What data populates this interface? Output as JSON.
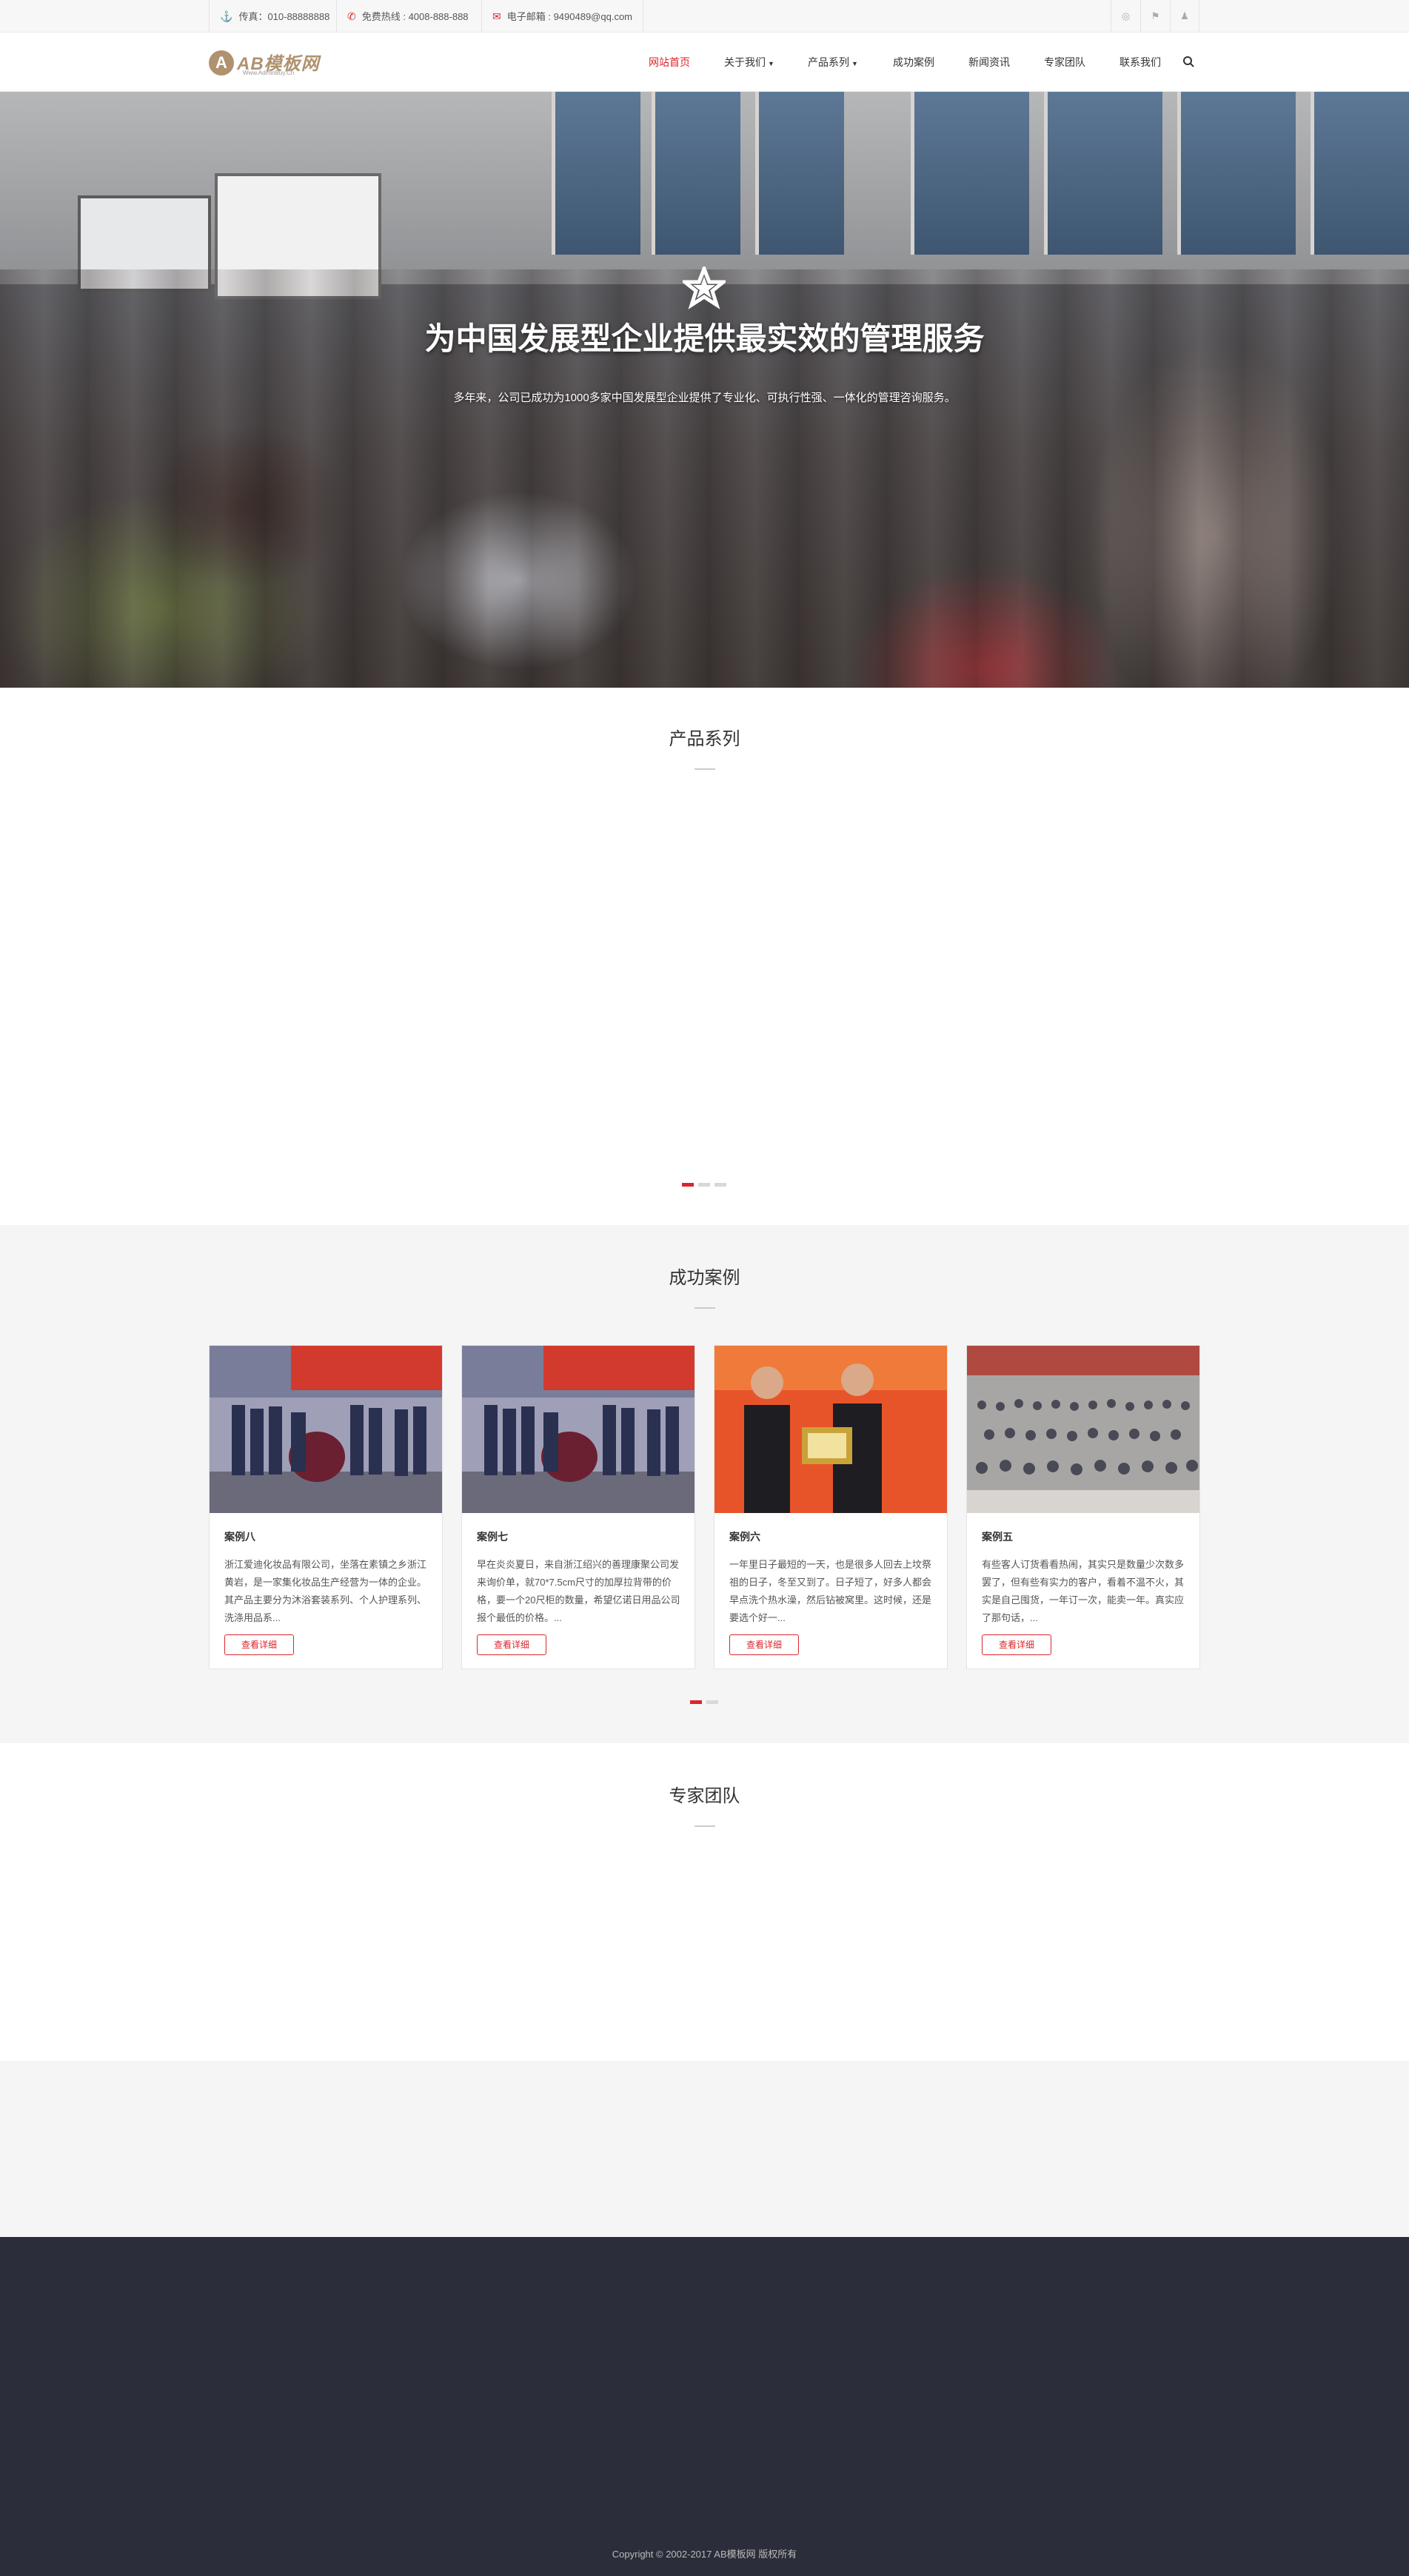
{
  "topbar": {
    "fax_label": "传真：010-88888888",
    "hotline_label": "免费热线 : 4008-888-888",
    "email_label": "电子邮箱 : 9490489@qq.com",
    "social_icons": [
      "weibo-icon",
      "flag-icon",
      "qq-icon"
    ]
  },
  "header": {
    "logo_text": "AB模板网",
    "logo_sub": "Www.AdminBuy.Cn",
    "nav": [
      {
        "label": "网站首页",
        "active": true
      },
      {
        "label": "关于我们",
        "dropdown": true
      },
      {
        "label": "产品系列",
        "dropdown": true
      },
      {
        "label": "成功案例"
      },
      {
        "label": "新闻资讯"
      },
      {
        "label": "专家团队"
      },
      {
        "label": "联系我们"
      }
    ]
  },
  "hero": {
    "title": "为中国发展型企业提供最实效的管理服务",
    "subtitle": "多年来，公司已成功为1000多家中国发展型企业提供了专业化、可执行性强、一体化的管理咨询服务。"
  },
  "products": {
    "title": "产品系列"
  },
  "cases": {
    "title": "成功案例",
    "button_label": "查看详细",
    "items": [
      {
        "title": "案例八",
        "desc": "浙江爱迪化妆品有限公司，坐落在素镇之乡浙江黄岩，是一家集化妆品生产经营为一体的企业。其产品主要分为沐浴套装系列、个人护理系列、洗涤用品系..."
      },
      {
        "title": "案例七",
        "desc": "早在炎炎夏日，来自浙江绍兴的善理康聚公司发来询价单，就70*7.5cm尺寸的加厚拉背带的价格，要一个20尺柜的数量，希望亿诺日用品公司报个最低的价格。..."
      },
      {
        "title": "案例六",
        "desc": "一年里日子最短的一天，也是很多人回去上坟祭祖的日子，冬至又到了。日子短了，好多人都会早点洗个热水澡，然后钻被窝里。这时候，还是要选个好一..."
      },
      {
        "title": "案例五",
        "desc": "有些客人订货看看热闹，其实只是数量少次数多罢了，但有些有实力的客户，看着不温不火，其实是自己囤货，一年订一次，能卖一年。真实应了那句话，..."
      }
    ]
  },
  "team": {
    "title": "专家团队"
  },
  "footer": {
    "copyright": "Copyright © 2002-2017 AB模板网 版权所有"
  },
  "colors": {
    "accent": "#d9262c",
    "brand": "#b09270",
    "footer_bg": "#2b2d3a",
    "section_bg": "#f5f5f5"
  }
}
